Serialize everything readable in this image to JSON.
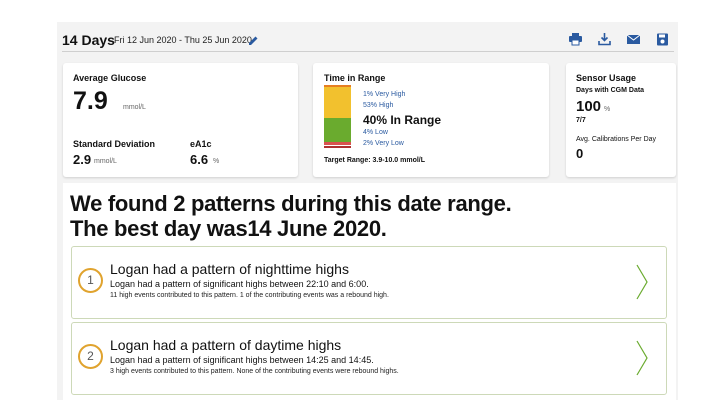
{
  "header": {
    "title": "14 Days",
    "date_range": "Fri 12 Jun 2020 - Thu 25 Jun 2020",
    "icons": [
      "edit-icon",
      "print-icon",
      "download-icon",
      "mail-icon",
      "save-icon"
    ],
    "accent_color": "#2a5aa0"
  },
  "glucose_card": {
    "avg_label": "Average Glucose",
    "avg_value": "7.9",
    "avg_unit": "mmol/L",
    "sd_label": "Standard Deviation",
    "sd_value": "2.9",
    "sd_unit": "mmol/L",
    "a1c_label": "eA1c",
    "a1c_value": "6.6",
    "a1c_unit": "%"
  },
  "tir_card": {
    "title": "Time in Range",
    "very_high": "1% Very High",
    "high": "53% High",
    "in_range": "40% In Range",
    "low": "4% Low",
    "very_low": "2% Very Low",
    "target": "Target Range: 3.9-10.0 mmol/L",
    "colors": {
      "high": "#f2c12e",
      "in_range": "#6aab2e",
      "low": "#d9534f"
    }
  },
  "sensor_card": {
    "title": "Sensor Usage",
    "days_label": "Days with CGM Data",
    "days_value": "100",
    "days_unit": "%",
    "days_fraction": "7/7",
    "cal_label": "Avg. Calibrations Per Day",
    "cal_value": "0"
  },
  "patterns": {
    "headline_line1": "We found 2 patterns during this date range.",
    "headline_line2": "The best day was14 June  2020.",
    "items": [
      {
        "number": "1",
        "title": "Logan had a pattern of nighttime highs",
        "subtitle": "Logan had a pattern of significant highs between 22:10 and 6:00.",
        "detail": "11 high events contributed to this pattern. 1 of the contributing events was a rebound high."
      },
      {
        "number": "2",
        "title": "Logan had a pattern of daytime highs",
        "subtitle": "Logan had a pattern of significant highs between 14:25 and 14:45.",
        "detail": "3 high events contributed to this pattern. None of the contributing events were rebound highs."
      }
    ]
  }
}
